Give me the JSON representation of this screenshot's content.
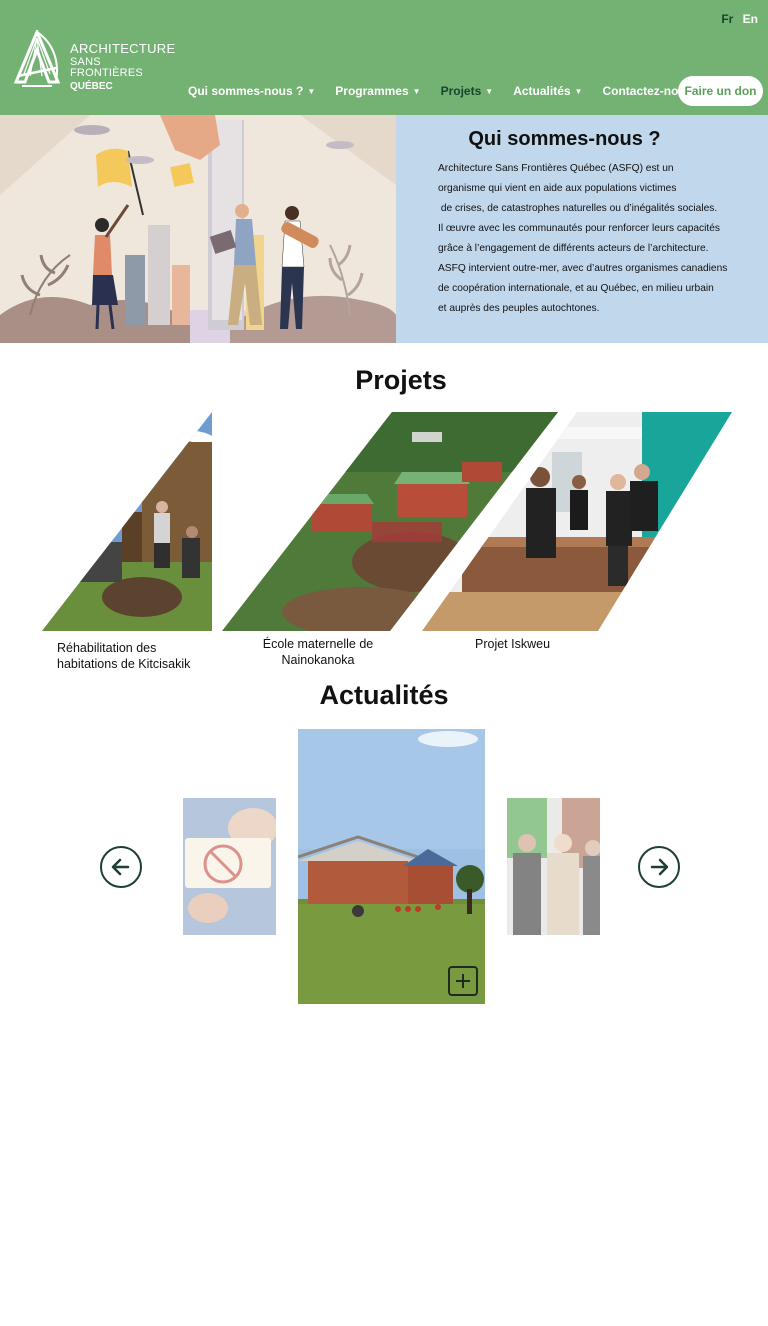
{
  "header": {
    "lang": {
      "fr": "Fr",
      "en": "En"
    },
    "logo": {
      "line1": "ARCHITECTURE",
      "line2": "SANS FRONTIÈRES",
      "line3": "QUÉBEC"
    },
    "nav": [
      {
        "label": "Qui sommes-nous ?",
        "has_dropdown": true
      },
      {
        "label": "Programmes",
        "has_dropdown": true
      },
      {
        "label": "Projets",
        "has_dropdown": true,
        "active": true
      },
      {
        "label": "Actualités",
        "has_dropdown": true
      },
      {
        "label": "Contactez-nous",
        "has_dropdown": true
      }
    ],
    "donate_label": "Faire un don"
  },
  "about": {
    "title": "Qui sommes-nous ?",
    "lines": [
      "Architecture Sans Frontières Québec (ASFQ) est un",
      "organisme qui vient en aide aux populations victimes",
      " de crises, de catastrophes naturelles ou d’inégalités sociales.",
      "Il œuvre avec les communautés pour renforcer leurs capacités",
      "grâce à l’engagement de différents acteurs de l’architecture.",
      "ASFQ intervient outre-mer, avec d’autres organismes canadiens",
      "de coopération internationale, et au Québec, en milieu urbain",
      "et auprès des peuples autochtones."
    ]
  },
  "projects": {
    "title": "Projets",
    "items": [
      {
        "label_lines": [
          "Réhabilitation des",
          "habitations de Kitcisakik"
        ]
      },
      {
        "label_lines": [
          "École maternelle de",
          "Nainokanoka"
        ]
      },
      {
        "label_lines": [
          "Projet Iskweu"
        ]
      }
    ]
  },
  "news": {
    "title": "Actualités",
    "prev_icon": "arrow-left-icon",
    "next_icon": "arrow-right-icon",
    "expand_icon": "plus-icon"
  },
  "colors": {
    "header_green": "#74b274",
    "nav_active": "#17442f",
    "about_bg": "#c1d7ec",
    "arrow": "#1e3e37"
  }
}
